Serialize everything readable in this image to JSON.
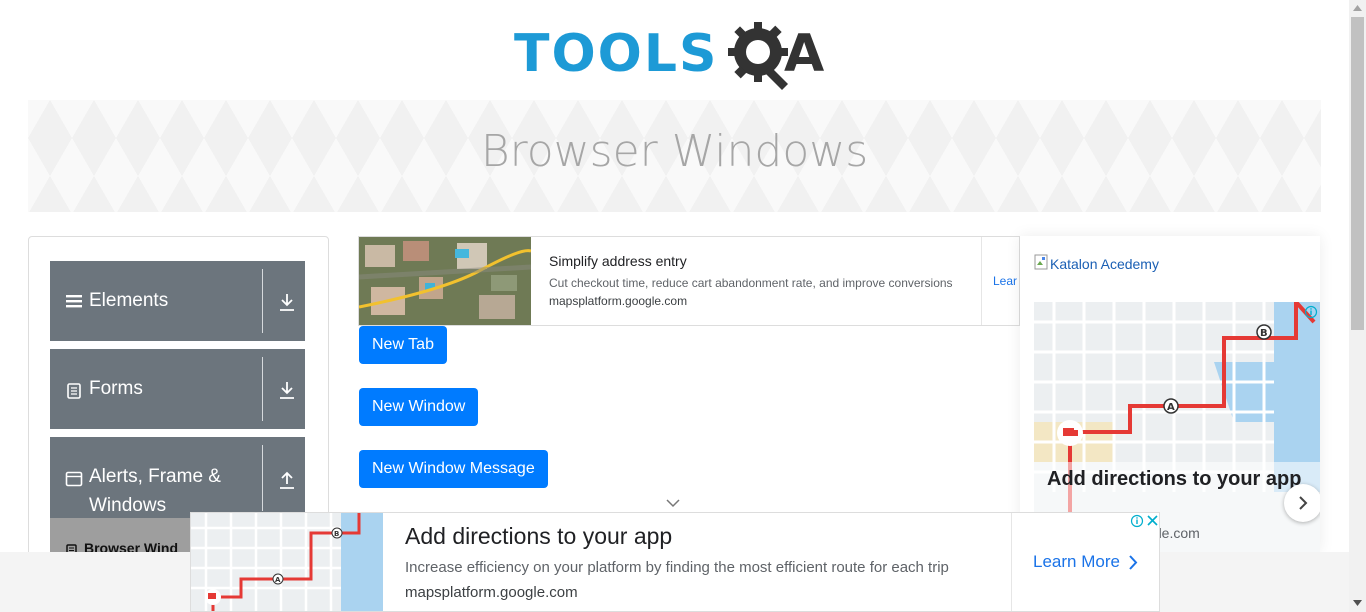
{
  "logo": {
    "part1": "TOOLS",
    "part2": "A",
    "icon": "gear-magnifier-icon"
  },
  "banner": {
    "title": "Browser Windows"
  },
  "sidebar": {
    "groups": [
      {
        "label": "Elements",
        "icon": "hamburger-icon",
        "arrow": "download-arrow-icon"
      },
      {
        "label": "Forms",
        "icon": "document-icon",
        "arrow": "download-arrow-icon"
      },
      {
        "label": "Alerts, Frame & Windows",
        "label_line1": "Alerts, Frame &",
        "label_line2": "Windows",
        "icon": "window-icon",
        "arrow": "upload-arrow-icon"
      }
    ],
    "active_item": "Browser Windows",
    "active_item_visible": "Browser Wind"
  },
  "top_ad": {
    "title": "Simplify address entry",
    "description": "Cut checkout time, reduce cart abandonment rate, and improve conversions",
    "url": "mapsplatform.google.com",
    "cta": "Lear"
  },
  "buttons": {
    "new_tab": "New Tab",
    "new_window": "New Window",
    "new_window_message": "New Window Message"
  },
  "right_ad": {
    "image_alt": "Katalon Acedemy",
    "title": "Add directions to your app",
    "url": "ogle.com"
  },
  "bottom_ad": {
    "title": "Add directions to your app",
    "description": "Increase efficiency on your platform by finding the most efficient route for each trip",
    "url": "mapsplatform.google.com",
    "cta": "Learn More"
  },
  "colors": {
    "primary": "#007bff",
    "sidebar_group": "#6c757d",
    "logo_blue": "#1d9ad6",
    "logo_dark": "#333333",
    "route_red": "#e53935"
  }
}
